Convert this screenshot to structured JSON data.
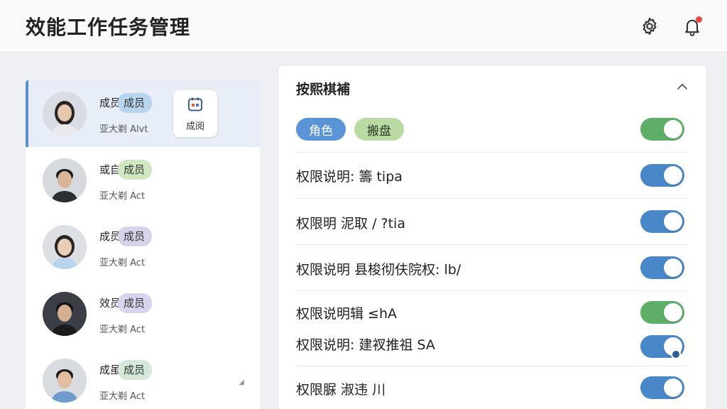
{
  "header": {
    "title": "效能工作任务管理",
    "settings_icon": "gear-icon",
    "notifications_icon": "bell-icon",
    "notification_dot_color": "#e8473f"
  },
  "members": [
    {
      "name": "成员",
      "role": "成员",
      "role_color": "#b9d4ef",
      "sub": "亚大剃 Alvt",
      "selected": true
    },
    {
      "name": "或自",
      "role": "成员",
      "role_color": "#cfe8c2",
      "sub": "亚大剃 Act",
      "selected": false
    },
    {
      "name": "成员",
      "role": "成员",
      "role_color": "#d7d3ea",
      "sub": "亚大剃 Act",
      "selected": false
    },
    {
      "name": "效员",
      "role": "成员",
      "role_color": "#d9d3ee",
      "sub": "亚大剃 Act",
      "selected": false
    },
    {
      "name": "成虽",
      "role": "成员",
      "role_color": "#d4e8da",
      "sub": "亚大剃 Act",
      "selected": false
    }
  ],
  "schedule_button": {
    "label": "成阅",
    "icon": "calendar-icon"
  },
  "permissions_panel": {
    "title": "按熙棋補",
    "collapse_icon": "chevron-up-icon",
    "tags": [
      {
        "label": "角色",
        "color": "blue"
      },
      {
        "label": "搬盘",
        "color": "green"
      }
    ],
    "header_toggle": {
      "on": true,
      "color": "green"
    },
    "rows": [
      {
        "label": "权限说明: 籌 tipa",
        "toggle_color": "blue",
        "on": true
      },
      {
        "label": "权限明  泥取 / ?tia",
        "toggle_color": "blue",
        "on": true
      },
      {
        "label": "权限说明 县梭彻伕院权: lb/",
        "toggle_color": "blue",
        "on": true
      },
      {
        "label": "权限说明辑 ≤hA",
        "toggle_color": "green",
        "on": true
      },
      {
        "label": "权限说明:  建衩推祖 SA",
        "toggle_color": "blue",
        "on": true
      },
      {
        "label": "权限脲  淑违 川",
        "toggle_color": "blue",
        "on": true
      }
    ]
  }
}
